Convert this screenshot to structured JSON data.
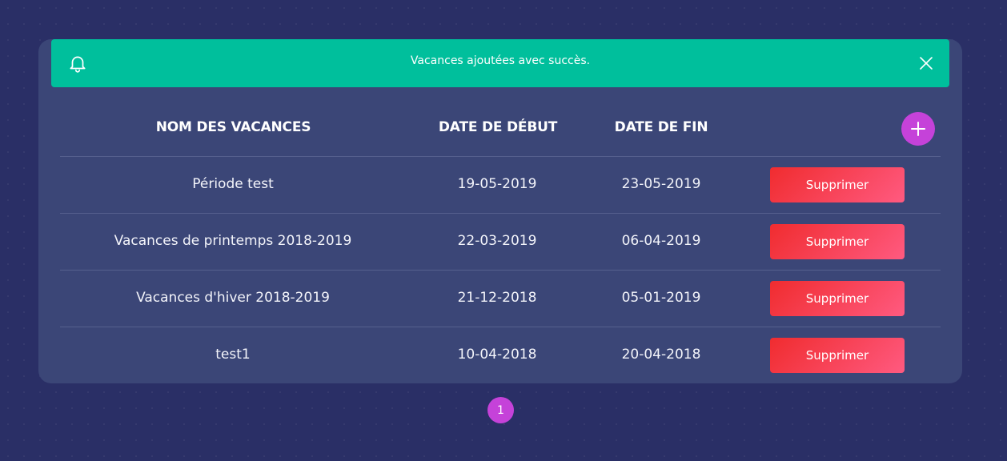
{
  "alert": {
    "message": "Vacances ajoutées avec succès.",
    "icon": "bell-icon",
    "close_icon": "close-icon",
    "color": "#00bf9c"
  },
  "table": {
    "headers": {
      "name": "NOM DES VACANCES",
      "start": "DATE DE DÉBUT",
      "end": "DATE DE FIN"
    },
    "add_icon": "plus-icon",
    "rows": [
      {
        "name": "Période test",
        "start": "19-05-2019",
        "end": "23-05-2019",
        "action": "Supprimer"
      },
      {
        "name": "Vacances de printemps 2018-2019",
        "start": "22-03-2019",
        "end": "06-04-2019",
        "action": "Supprimer"
      },
      {
        "name": "Vacances d'hiver 2018-2019",
        "start": "21-12-2018",
        "end": "05-01-2019",
        "action": "Supprimer"
      },
      {
        "name": "test1",
        "start": "10-04-2018",
        "end": "20-04-2018",
        "action": "Supprimer"
      }
    ]
  },
  "pagination": {
    "current": "1"
  },
  "colors": {
    "background": "#2a2f66",
    "card": "#3b4677",
    "accent": "#c542d9",
    "danger": "#f02c2f"
  }
}
